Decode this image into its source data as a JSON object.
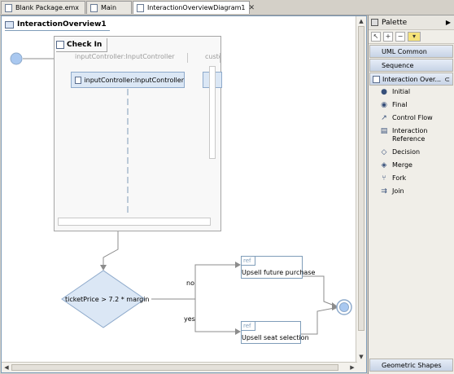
{
  "tabs": [
    {
      "label": "Blank Package.emx",
      "active": false
    },
    {
      "label": "Main",
      "active": false
    },
    {
      "label": "InteractionOverviewDiagram1",
      "active": true,
      "close": "✕"
    }
  ],
  "editor": {
    "diagram_title": "InteractionOverview1",
    "frame": {
      "title": "Check In",
      "lane_header_1": "inputController:InputController",
      "lane_header_2": "custo",
      "lifeline_label": "inputController:InputController"
    },
    "decision": {
      "guard": "ticketPrice > 7.2 * margin",
      "no_label": "no",
      "yes_label": "yes"
    },
    "refs": [
      {
        "tag": "ref",
        "label": "Upsell future purchase"
      },
      {
        "tag": "ref",
        "label": "Upsell seat selection"
      }
    ]
  },
  "palette": {
    "title": "Palette",
    "drawers": [
      {
        "label": "UML Common"
      },
      {
        "label": "Sequence"
      },
      {
        "label": "Interaction Over..."
      }
    ],
    "items": [
      {
        "label": "Initial",
        "icon": "initial-node-icon"
      },
      {
        "label": "Final",
        "icon": "final-node-icon"
      },
      {
        "label": "Control Flow",
        "icon": "control-flow-icon"
      },
      {
        "label": "Interaction Reference",
        "icon": "interaction-reference-icon"
      },
      {
        "label": "Decision",
        "icon": "decision-icon"
      },
      {
        "label": "Merge",
        "icon": "merge-icon"
      },
      {
        "label": "Fork",
        "icon": "fork-icon"
      },
      {
        "label": "Join",
        "icon": "join-icon"
      }
    ],
    "bottom_drawer": "Geometric Shapes"
  },
  "colors": {
    "node_fill": "#dbe7f5",
    "node_stroke": "#8eaacb",
    "initial_fill": "#a9c8f0"
  }
}
